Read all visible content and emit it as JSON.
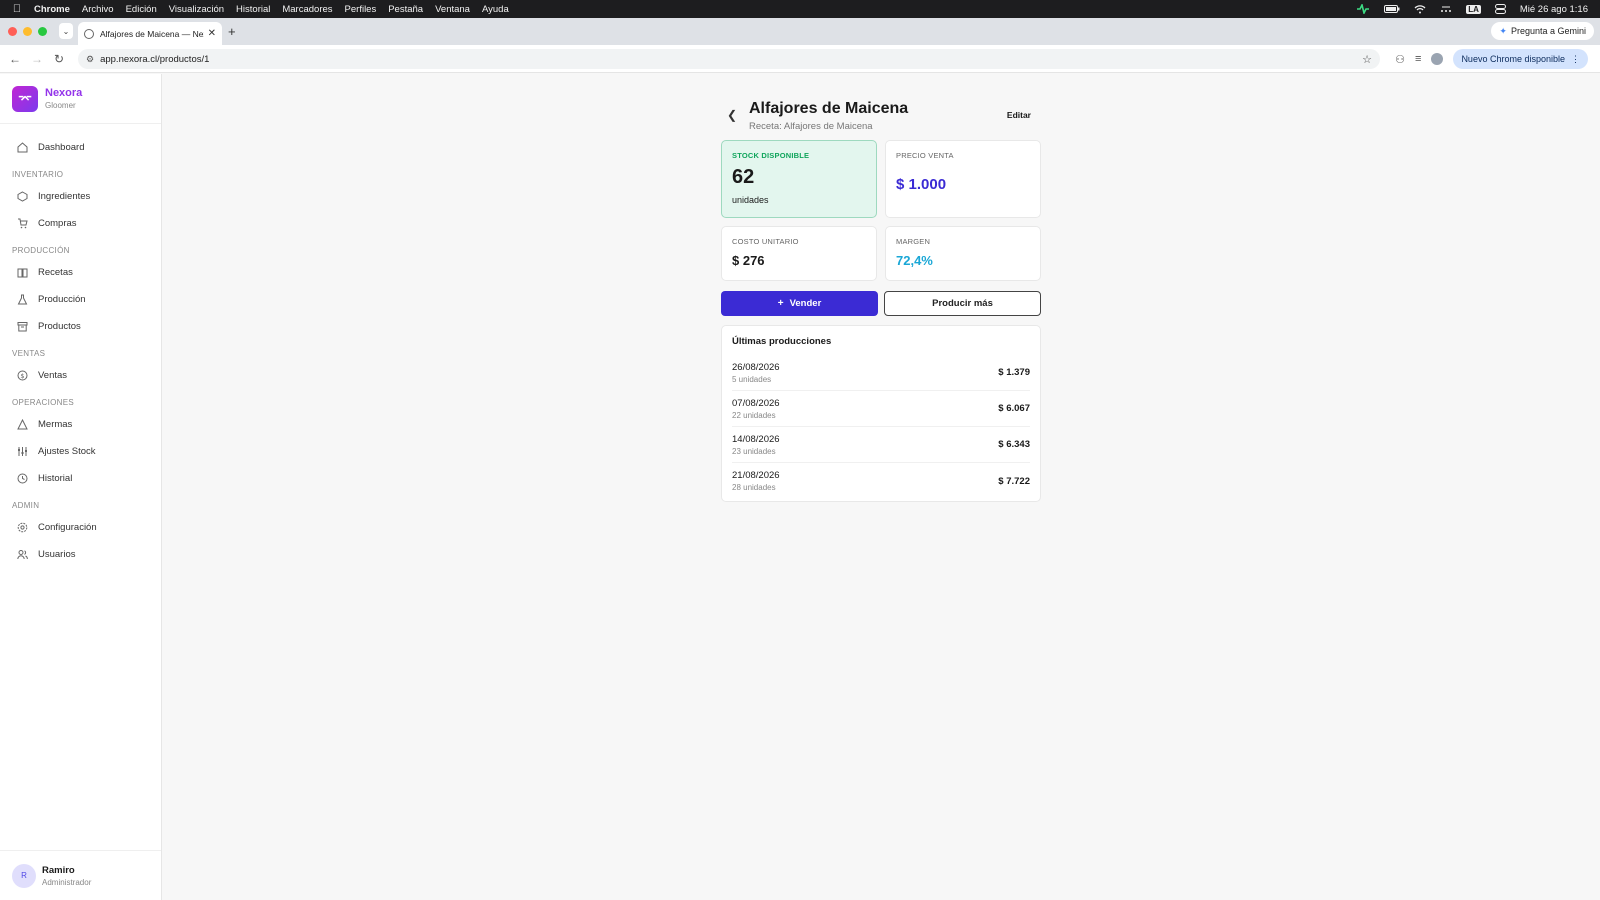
{
  "menubar": {
    "app": "Chrome",
    "items": [
      "Archivo",
      "Edición",
      "Visualización",
      "Historial",
      "Marcadores",
      "Perfiles",
      "Pestaña",
      "Ventana",
      "Ayuda"
    ],
    "clock": "Mié 26 ago 1:16",
    "input_badge": "LA"
  },
  "browser": {
    "tab_title": "Alfajores de Maicena — Nexora",
    "url": "app.nexora.cl/productos/1",
    "gemini_label": "Pregunta a Gemini",
    "update_label": "Nuevo Chrome disponible"
  },
  "sidebar": {
    "brand_name": "Nexora",
    "brand_sub": "Gloomer",
    "dashboard": "Dashboard",
    "sections": [
      {
        "title": "INVENTARIO",
        "items": [
          "Ingredientes",
          "Compras"
        ]
      },
      {
        "title": "PRODUCCIÓN",
        "items": [
          "Recetas",
          "Producción",
          "Productos"
        ]
      },
      {
        "title": "VENTAS",
        "items": [
          "Ventas"
        ]
      },
      {
        "title": "OPERACIONES",
        "items": [
          "Mermas",
          "Ajustes Stock",
          "Historial"
        ]
      },
      {
        "title": "ADMIN",
        "items": [
          "Configuración",
          "Usuarios"
        ]
      }
    ],
    "user": {
      "initial": "R",
      "name": "Ramiro",
      "role": "Administrador"
    }
  },
  "product": {
    "title": "Alfajores de Maicena",
    "subtitle": "Receta: Alfajores de Maicena",
    "edit_label": "Editar",
    "stock_label": "STOCK DISPONIBLE",
    "stock_value": "62",
    "stock_unit": "unidades",
    "price_label": "PRECIO VENTA",
    "price_value": "$ 1.000",
    "cost_label": "COSTO UNITARIO",
    "cost_value": "$ 276",
    "margin_label": "MARGEN",
    "margin_value": "72,4%",
    "sell_label": "Vender",
    "produce_label": "Producir más"
  },
  "productions": {
    "title": "Últimas producciones",
    "rows": [
      {
        "date": "26/08/2026",
        "units": "5 unidades",
        "amount": "$ 1.379"
      },
      {
        "date": "07/08/2026",
        "units": "22 unidades",
        "amount": "$ 6.067"
      },
      {
        "date": "14/08/2026",
        "units": "23 unidades",
        "amount": "$ 6.343"
      },
      {
        "date": "21/08/2026",
        "units": "28 unidades",
        "amount": "$ 7.722"
      }
    ]
  },
  "colors": {
    "accent": "#3b2bd4",
    "brand": "#9333ea",
    "stock_green": "#10a55c",
    "margin_blue": "#1aa7d6"
  }
}
